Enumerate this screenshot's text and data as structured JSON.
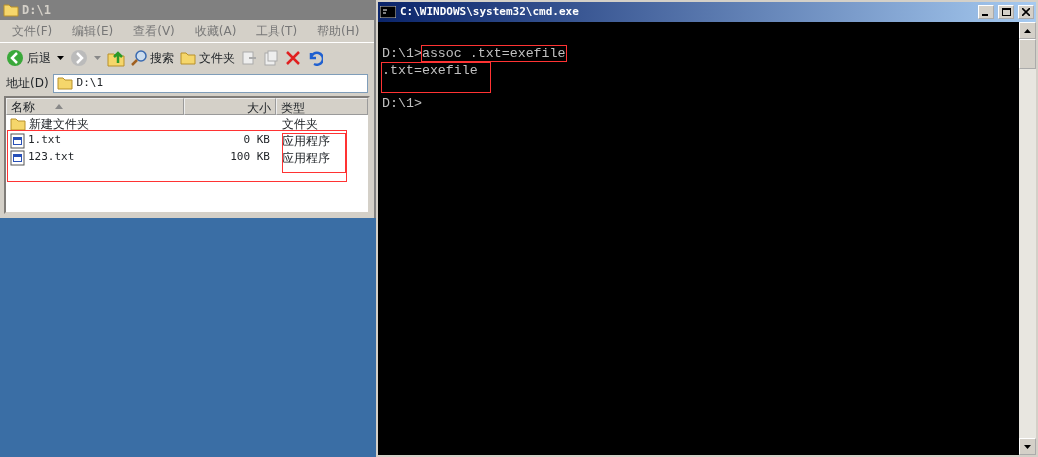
{
  "explorer": {
    "title": "D:\\1",
    "menu": [
      "文件(F)",
      "编辑(E)",
      "查看(V)",
      "收藏(A)",
      "工具(T)",
      "帮助(H)"
    ],
    "toolbar": {
      "back": "后退",
      "search": "搜索",
      "folders": "文件夹"
    },
    "address": {
      "label": "地址(D)",
      "value": "D:\\1"
    },
    "columns": [
      "名称",
      "大小",
      "类型"
    ],
    "rows": [
      {
        "kind": "folder",
        "name": "新建文件夹",
        "size": "",
        "type": "文件夹",
        "highlighted": false
      },
      {
        "kind": "app",
        "name": "1.txt",
        "size": "0 KB",
        "type": "应用程序",
        "highlighted": true
      },
      {
        "kind": "app",
        "name": "123.txt",
        "size": "100 KB",
        "type": "应用程序",
        "highlighted": true
      }
    ]
  },
  "console": {
    "title": "C:\\WINDOWS\\system32\\cmd.exe",
    "lines": [
      {
        "kind": "prompt",
        "prompt": "D:\\1>",
        "command": "assoc .txt=exefile",
        "highlighted": true
      },
      {
        "kind": "output",
        "text": ".txt=exefile",
        "highlighted": true
      },
      {
        "kind": "blank"
      },
      {
        "kind": "prompt",
        "prompt": "D:\\1>",
        "highlighted": false
      }
    ]
  }
}
